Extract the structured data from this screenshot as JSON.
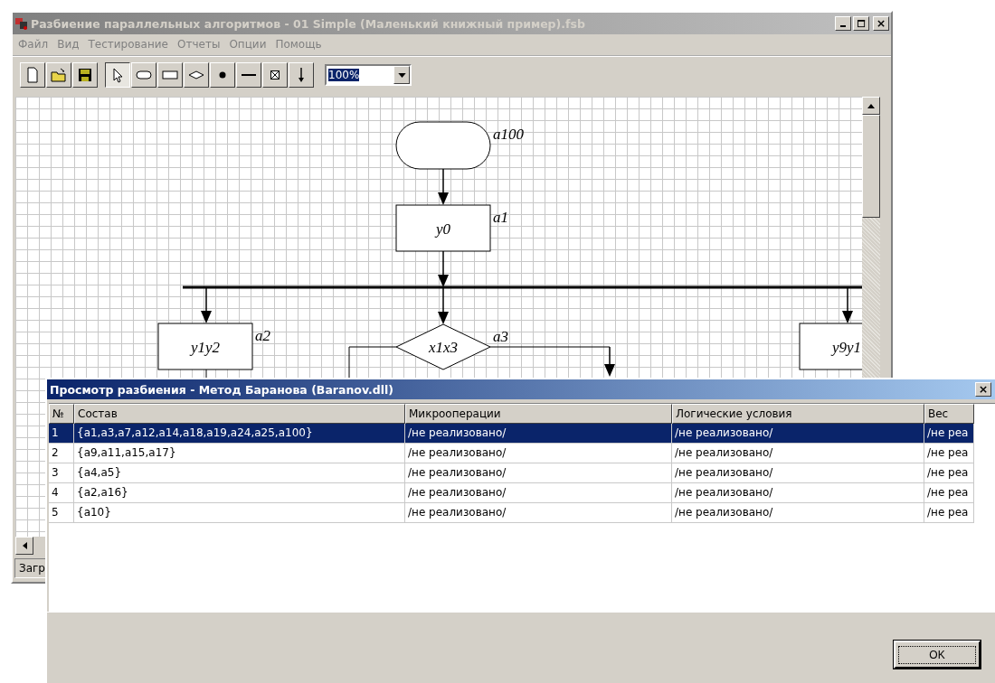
{
  "main_window": {
    "title": "Разбиение параллельных алгоритмов - 01 Simple (Маленький книжный пример).fsb",
    "menu": [
      "Файл",
      "Вид",
      "Тестирование",
      "Отчеты",
      "Опции",
      "Помощь"
    ],
    "toolbar": [
      {
        "kind": "new",
        "selected": false
      },
      {
        "kind": "open",
        "selected": false
      },
      {
        "kind": "save",
        "selected": false
      },
      {
        "kind": "pointer",
        "selected": true
      },
      {
        "kind": "oval",
        "selected": false
      },
      {
        "kind": "rect",
        "selected": false
      },
      {
        "kind": "diamond",
        "selected": false
      },
      {
        "kind": "dot",
        "selected": false
      },
      {
        "kind": "line",
        "selected": false
      },
      {
        "kind": "crossbox",
        "selected": false
      },
      {
        "kind": "arrow",
        "selected": false
      }
    ],
    "zoom": "100%",
    "status_bar": "Загр"
  },
  "diagram": {
    "nodes": [
      {
        "kind": "terminal",
        "label": "a100"
      },
      {
        "kind": "process",
        "text": "y0",
        "label": "a1"
      },
      {
        "kind": "process",
        "text": "y1y2",
        "label": "a2"
      },
      {
        "kind": "condition",
        "text": "x1x3",
        "label": "a3"
      },
      {
        "kind": "process",
        "text": "y9y1"
      }
    ]
  },
  "dialog": {
    "title": "Просмотр разбиения - Метод Баранова (Baranov.dll)",
    "columns": [
      "№",
      "Состав",
      "Микрооперации",
      "Логические условия",
      "Вес"
    ],
    "rows": [
      {
        "selected": true,
        "cells": [
          "1",
          "{a1,a3,a7,a12,a14,a18,a19,a24,a25,a100}",
          "/не реализовано/",
          "/не реализовано/",
          "/не реа"
        ]
      },
      {
        "selected": false,
        "cells": [
          "2",
          "{a9,a11,a15,a17}",
          "/не реализовано/",
          "/не реализовано/",
          "/не реа"
        ]
      },
      {
        "selected": false,
        "cells": [
          "3",
          "{a4,a5}",
          "/не реализовано/",
          "/не реализовано/",
          "/не реа"
        ]
      },
      {
        "selected": false,
        "cells": [
          "4",
          "{a2,a16}",
          "/не реализовано/",
          "/не реализовано/",
          "/не реа"
        ]
      },
      {
        "selected": false,
        "cells": [
          "5",
          "{a10}",
          "/не реализовано/",
          "/не реализовано/",
          "/не реа"
        ]
      }
    ],
    "ok_button": "OK"
  }
}
